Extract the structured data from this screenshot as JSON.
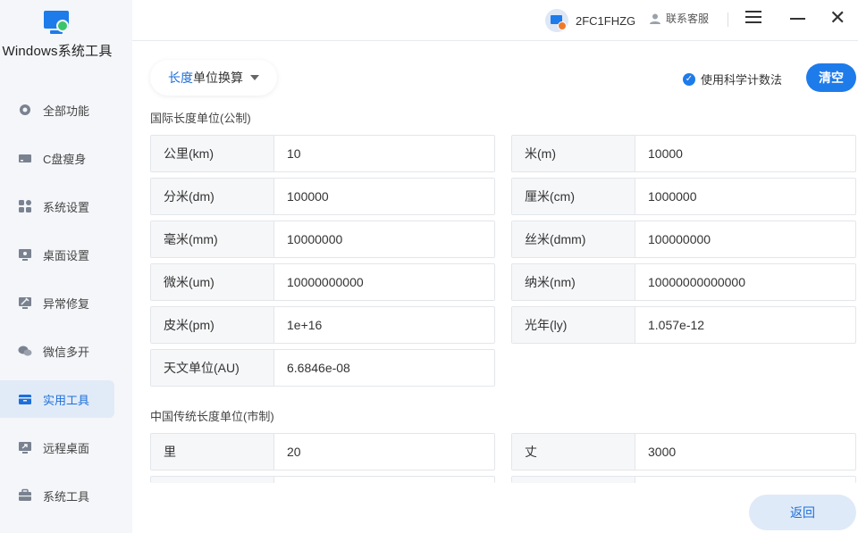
{
  "app": {
    "title": "Windows系统工具"
  },
  "sidebar": {
    "items": [
      {
        "label": "全部功能",
        "icon": "gear-icon"
      },
      {
        "label": "C盘瘦身",
        "icon": "disk-icon"
      },
      {
        "label": "系统设置",
        "icon": "grid-icon"
      },
      {
        "label": "桌面设置",
        "icon": "monitor-icon"
      },
      {
        "label": "异常修复",
        "icon": "repair-icon"
      },
      {
        "label": "微信多开",
        "icon": "wechat-icon"
      },
      {
        "label": "实用工具",
        "icon": "toolbox-icon",
        "active": true
      },
      {
        "label": "远程桌面",
        "icon": "remote-icon"
      },
      {
        "label": "系统工具",
        "icon": "briefcase-icon"
      }
    ]
  },
  "header": {
    "device_name": "2FC1FHZG",
    "support_label": "联系客服"
  },
  "toolbar": {
    "dropdown_highlight": "长度",
    "dropdown_rest": "单位换算",
    "sci_label": "使用科学计数法",
    "clear_label": "清空",
    "back_label": "返回"
  },
  "metric": {
    "title": "国际长度单位(公制)",
    "rows": [
      {
        "label": "公里(km)",
        "value": "10"
      },
      {
        "label": "米(m)",
        "value": "10000"
      },
      {
        "label": "分米(dm)",
        "value": "100000"
      },
      {
        "label": "厘米(cm)",
        "value": "1000000"
      },
      {
        "label": "毫米(mm)",
        "value": "10000000"
      },
      {
        "label": "丝米(dmm)",
        "value": "100000000"
      },
      {
        "label": "微米(um)",
        "value": "10000000000"
      },
      {
        "label": "纳米(nm)",
        "value": "10000000000000"
      },
      {
        "label": "皮米(pm)",
        "value": "1e+16"
      },
      {
        "label": "光年(ly)",
        "value": "1.057e-12"
      },
      {
        "label": "天文单位(AU)",
        "value": "6.6846e-08"
      }
    ]
  },
  "chinese": {
    "title": "中国传统长度单位(市制)",
    "rows": [
      {
        "label": "里",
        "value": "20"
      },
      {
        "label": "丈",
        "value": "3000"
      }
    ]
  },
  "colors": {
    "accent": "#1e7bea",
    "active_bg": "#e1ebf8"
  }
}
